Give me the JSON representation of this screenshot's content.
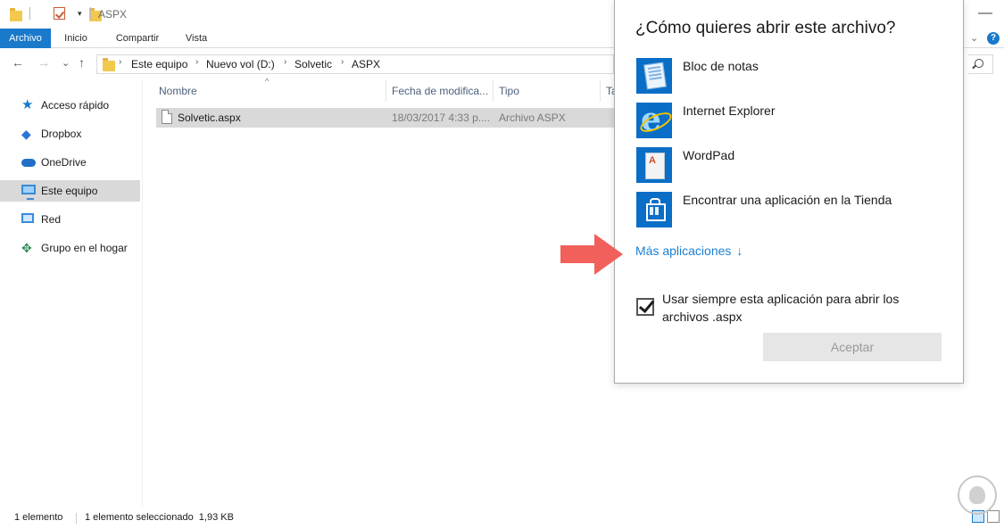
{
  "window": {
    "title": "ASPX",
    "minimize_glyph": "—"
  },
  "quick_access": {
    "dropdown_glyph": "▾"
  },
  "ribbon": {
    "tabs": [
      {
        "label": "Archivo",
        "active": true
      },
      {
        "label": "Inicio",
        "active": false
      },
      {
        "label": "Compartir",
        "active": false
      },
      {
        "label": "Vista",
        "active": false
      }
    ],
    "expand_glyph": "⌄",
    "help_glyph": "?"
  },
  "address": {
    "back_glyph": "←",
    "forward_glyph": "→",
    "recent_glyph": "⌄",
    "up_glyph": "↑",
    "crumbs": [
      "Este equipo",
      "Nuevo vol (D:)",
      "Solvetic",
      "ASPX"
    ],
    "sep_glyph": "›"
  },
  "sidebar": {
    "items": [
      {
        "label": "Acceso rápido",
        "icon": "star-icon"
      },
      {
        "label": "Dropbox",
        "icon": "dropbox-icon"
      },
      {
        "label": "OneDrive",
        "icon": "cloud-icon"
      },
      {
        "label": "Este equipo",
        "icon": "computer-icon",
        "selected": true
      },
      {
        "label": "Red",
        "icon": "network-icon"
      },
      {
        "label": "Grupo en el hogar",
        "icon": "homegroup-icon"
      }
    ]
  },
  "file_list": {
    "columns": [
      "Nombre",
      "Fecha de modifica...",
      "Tipo",
      "Ta"
    ],
    "sort_glyph": "^",
    "rows": [
      {
        "name": "Solvetic.aspx",
        "date": "18/03/2017 4:33 p....",
        "type": "Archivo ASPX"
      }
    ]
  },
  "status_bar": {
    "count": "1 elemento",
    "selection": "1 elemento seleccionado  1,93 KB"
  },
  "dialog": {
    "title": "¿Cómo quieres abrir este archivo?",
    "apps": [
      {
        "label": "Bloc de notas",
        "icon": "notepad-icon"
      },
      {
        "label": "Internet Explorer",
        "icon": "internet-explorer-icon"
      },
      {
        "label": "WordPad",
        "icon": "wordpad-icon"
      },
      {
        "label": "Encontrar una aplicación en la Tienda",
        "icon": "store-icon"
      }
    ],
    "more_apps": "Más aplicaciones",
    "more_apps_glyph": "↓",
    "always_use": "Usar siempre esta aplicación para abrir los archivos .aspx",
    "always_use_checked": true,
    "ok_button": "Aceptar",
    "ie_glyph": "e",
    "wordpad_glyph": "A"
  },
  "colors": {
    "accent": "#1979ca",
    "link": "#1a7fd1",
    "tile": "#0a6ec7",
    "arrow": "#f2605b",
    "selection": "#d9d9d9"
  }
}
